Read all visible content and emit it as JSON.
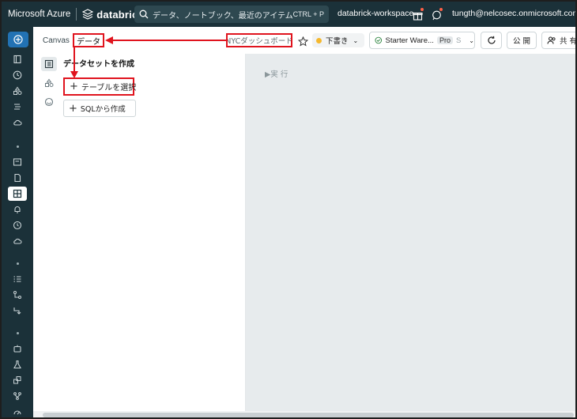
{
  "topbar": {
    "brand": "Microsoft Azure",
    "product": "databricks",
    "search_placeholder": "データ、ノートブック、最近のアイテムな...",
    "search_shortcut": "CTRL + P",
    "workspace": "databrick-workspace",
    "user": "tungth@nelcosec.onmicrosoft.com"
  },
  "toolbar": {
    "canvas_tab": "Canvas",
    "data_tab": "データ",
    "dashboard_title": "NYCダッシュボード",
    "draft_label": "下書き",
    "warehouse_label": "Starter Ware...",
    "warehouse_badge": "Pro",
    "warehouse_size": "S",
    "publish_label": "公 開",
    "share_label": "共 有"
  },
  "panel": {
    "title": "データセットを作成",
    "select_table": "テーブルを選択",
    "sql_create": "SQLから作成"
  },
  "editor": {
    "run_label": "▶実 行"
  },
  "colors": {
    "nav_bg": "#1b3139",
    "accent": "#2272b4",
    "highlight": "#e0141e",
    "draft_dot": "#f5b82e",
    "status_green": "#2e8540"
  }
}
